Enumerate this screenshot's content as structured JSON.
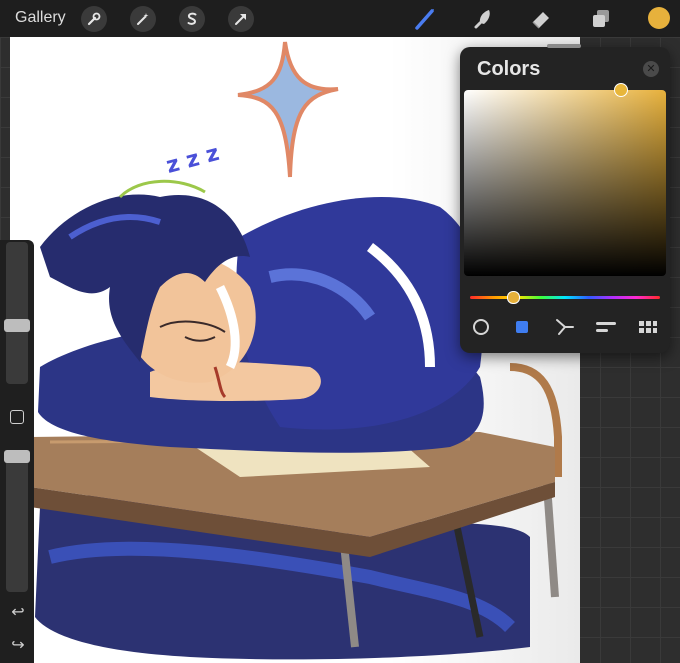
{
  "toolbar": {
    "gallery_label": "Gallery",
    "left_tools": [
      "wrench-icon",
      "magic-wand-icon",
      "selection-s-icon",
      "transform-arrow-icon"
    ],
    "right_tools": [
      "brush-icon",
      "smudge-icon",
      "eraser-icon",
      "layers-icon"
    ],
    "active_color": "#e7b13c",
    "brush_accent": "#4a7cf0"
  },
  "colors_panel": {
    "title": "Colors",
    "close_glyph": "✕",
    "hue_accent": "#e7b13c",
    "modes": [
      "disc-icon",
      "classic-square-icon",
      "harmony-icon",
      "value-sliders-icon",
      "palettes-icon"
    ],
    "active_mode": "classic-square-icon"
  },
  "sidebar": {
    "undo_glyph": "↩",
    "redo_glyph": "↪",
    "brush_size_level": 0.4,
    "opacity_level": 1.0
  }
}
